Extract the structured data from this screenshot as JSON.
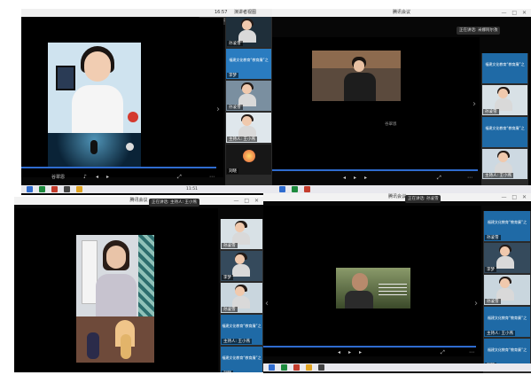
{
  "quadrants": {
    "tl": {
      "clock": "16:57",
      "view_label": "演讲者视图",
      "speaking": "正在讲话: 孙凌雪",
      "caption_name": "谷翠恩",
      "taskbar_time": "11:51"
    },
    "tr": {
      "app_title": "腾讯会议",
      "speaking": "正在讲话: 米娜阿尔孜",
      "inner_caption": "谷翠恩"
    },
    "bl": {
      "app_title": "腾讯会议",
      "speaking": "正在讲话: 主持人: 王小燕"
    },
    "br": {
      "app_title": "腾讯会议",
      "speaking": "正在讲话: 孙凌雪"
    }
  },
  "sidebars": {
    "tl": [
      "孙凌雪",
      "李梦",
      "孙凌雪",
      "主持人: 王小燕",
      "刘晓",
      "黄振宇"
    ],
    "tr": [
      "",
      "孙凌雪",
      "",
      "主持人: 王小燕",
      "刘晓",
      ""
    ],
    "bl": [
      "孙凌雪",
      "李梦",
      "孙凌雪",
      "主持人: 王小燕",
      "刘晓",
      ""
    ],
    "br": [
      "孙凌雪",
      "李梦",
      "孙凌雪",
      "主持人: 王小燕",
      "刘晓",
      ""
    ]
  },
  "banner_text": "福建文化教育“教育廉”之",
  "colors": {
    "accent": "#2f6ccf",
    "window_bg": "#070707",
    "banner": "#1f6aa6"
  }
}
